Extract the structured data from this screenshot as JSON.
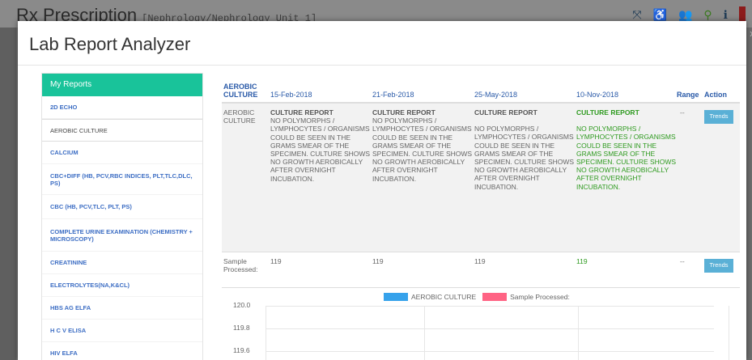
{
  "app": {
    "title": "Rx Prescription",
    "subtitle": "[Nephrology/Nephrology Unit 1]"
  },
  "modal": {
    "title": "Lab Report Analyzer",
    "close": "x"
  },
  "sidebar": {
    "header": "My Reports",
    "items": [
      {
        "label": "2D ECHO",
        "active": false
      },
      {
        "label": "AEROBIC CULTURE",
        "active": true
      },
      {
        "label": "CALCIUM",
        "active": false
      },
      {
        "label": "CBC+DIFF (HB, PCV,RBC INDICES, PLT,TLC,DLC, PS)",
        "active": false
      },
      {
        "label": "CBC (HB, PCV,TLC, PLT, PS)",
        "active": false
      },
      {
        "label": "COMPLETE URINE EXAMINATION (CHEMISTRY + MICROSCOPY)",
        "active": false
      },
      {
        "label": "CREATININE",
        "active": false
      },
      {
        "label": "ELECTROLYTES(NA,K&CL)",
        "active": false
      },
      {
        "label": "HBS AG ELFA",
        "active": false
      },
      {
        "label": "H C V ELISA",
        "active": false
      },
      {
        "label": "HIV ELFA",
        "active": false
      }
    ]
  },
  "table": {
    "headers": [
      "AEROBIC CULTURE",
      "15-Feb-2018",
      "21-Feb-2018",
      "25-May-2018",
      "10-Nov-2018",
      "Range",
      "Action"
    ],
    "rows": [
      {
        "test": "AEROBIC CULTURE",
        "values": [
          {
            "head": "CULTURE REPORT",
            "body": "NO POLYMORPHS / LYMPHOCYTES / ORGANISMS COULD BE SEEN IN THE GRAMS SMEAR OF THE SPECIMEN. CULTURE SHOWS NO GROWTH AEROBICALLY AFTER OVERNIGHT INCUBATION."
          },
          {
            "head": "CULTURE REPORT",
            "body": "NO POLYMORPHS / LYMPHOCYTES / ORGANISMS COULD BE SEEN IN THE GRAMS SMEAR OF THE SPECIMEN. CULTURE SHOWS NO GROWTH AEROBICALLY AFTER OVERNIGHT INCUBATION."
          },
          {
            "head": "CULTURE REPORT",
            "body": "NO POLYMORPHS / LYMPHOCYTES / ORGANISMS COULD BE SEEN IN THE GRAMS SMEAR OF THE SPECIMEN. CULTURE SHOWS NO GROWTH AEROBICALLY AFTER OVERNIGHT INCUBATION."
          },
          {
            "head": "CULTURE REPORT",
            "body": "NO POLYMORPHS / LYMPHOCYTES / ORGANISMS COULD BE SEEN IN THE GRAMS SMEAR OF THE SPECIMEN. CULTURE SHOWS NO GROWTH AEROBICALLY AFTER OVERNIGHT INCUBATION."
          }
        ],
        "range": "--",
        "action": "Trends"
      },
      {
        "test": "Sample Processed:",
        "values": [
          "119",
          "119",
          "119",
          "119"
        ],
        "range": "--",
        "action": "Trends"
      }
    ]
  },
  "chart": {
    "legend": [
      {
        "label": "AEROBIC CULTURE",
        "color": "#36a2eb"
      },
      {
        "label": "Sample Processed:",
        "color": "#ff6384"
      }
    ],
    "yticks": [
      "120.0",
      "119.8",
      "119.6"
    ]
  },
  "colors": {
    "accent": "#19c39a",
    "link": "#3d6ec4",
    "latest": "#2e9a1f",
    "button": "#5ab0d6"
  }
}
